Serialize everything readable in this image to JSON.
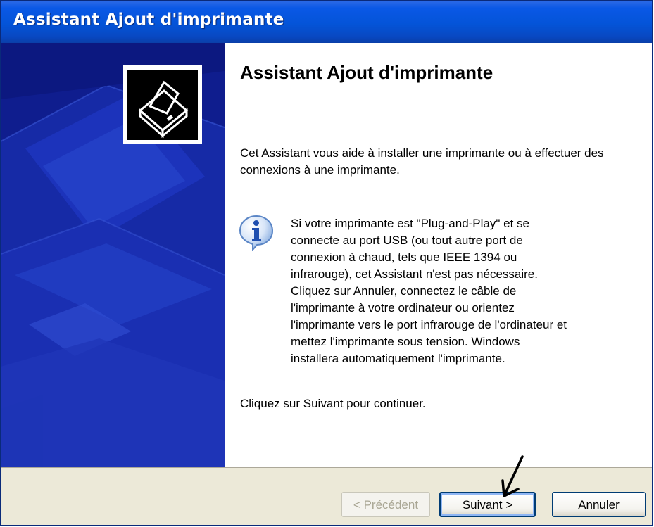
{
  "window": {
    "title": "Assistant Ajout d'imprimante"
  },
  "content": {
    "heading": "Assistant Ajout d'imprimante",
    "intro": "Cet Assistant vous aide à installer une imprimante ou à effectuer des connexions à une imprimante.",
    "info_lines": [
      "Si votre imprimante est \"Plug-and-Play\" et se",
      "connecte au port USB (ou tout autre port de",
      "connexion à chaud, tels que IEEE 1394 ou",
      "infrarouge), cet Assistant n'est pas nécessaire.",
      "Cliquez sur Annuler, connectez le câble de",
      "l'imprimante à votre ordinateur ou orientez",
      "l'imprimante vers le port infrarouge de l'ordinateur et",
      "mettez l'imprimante sous tension. Windows",
      "installera automatiquement l'imprimante."
    ],
    "continue_text": "Cliquez sur Suivant pour continuer."
  },
  "buttons": {
    "previous": "< Précédent",
    "next": "Suivant >",
    "cancel": "Annuler"
  },
  "icons": {
    "wizard": "printer-icon",
    "info": "info-icon",
    "annotation": "hand-drawn-arrow-icon"
  },
  "colors": {
    "titlebar": "#0454d8",
    "left_panel": "#0f1d8e",
    "footer": "#ece9d8"
  }
}
